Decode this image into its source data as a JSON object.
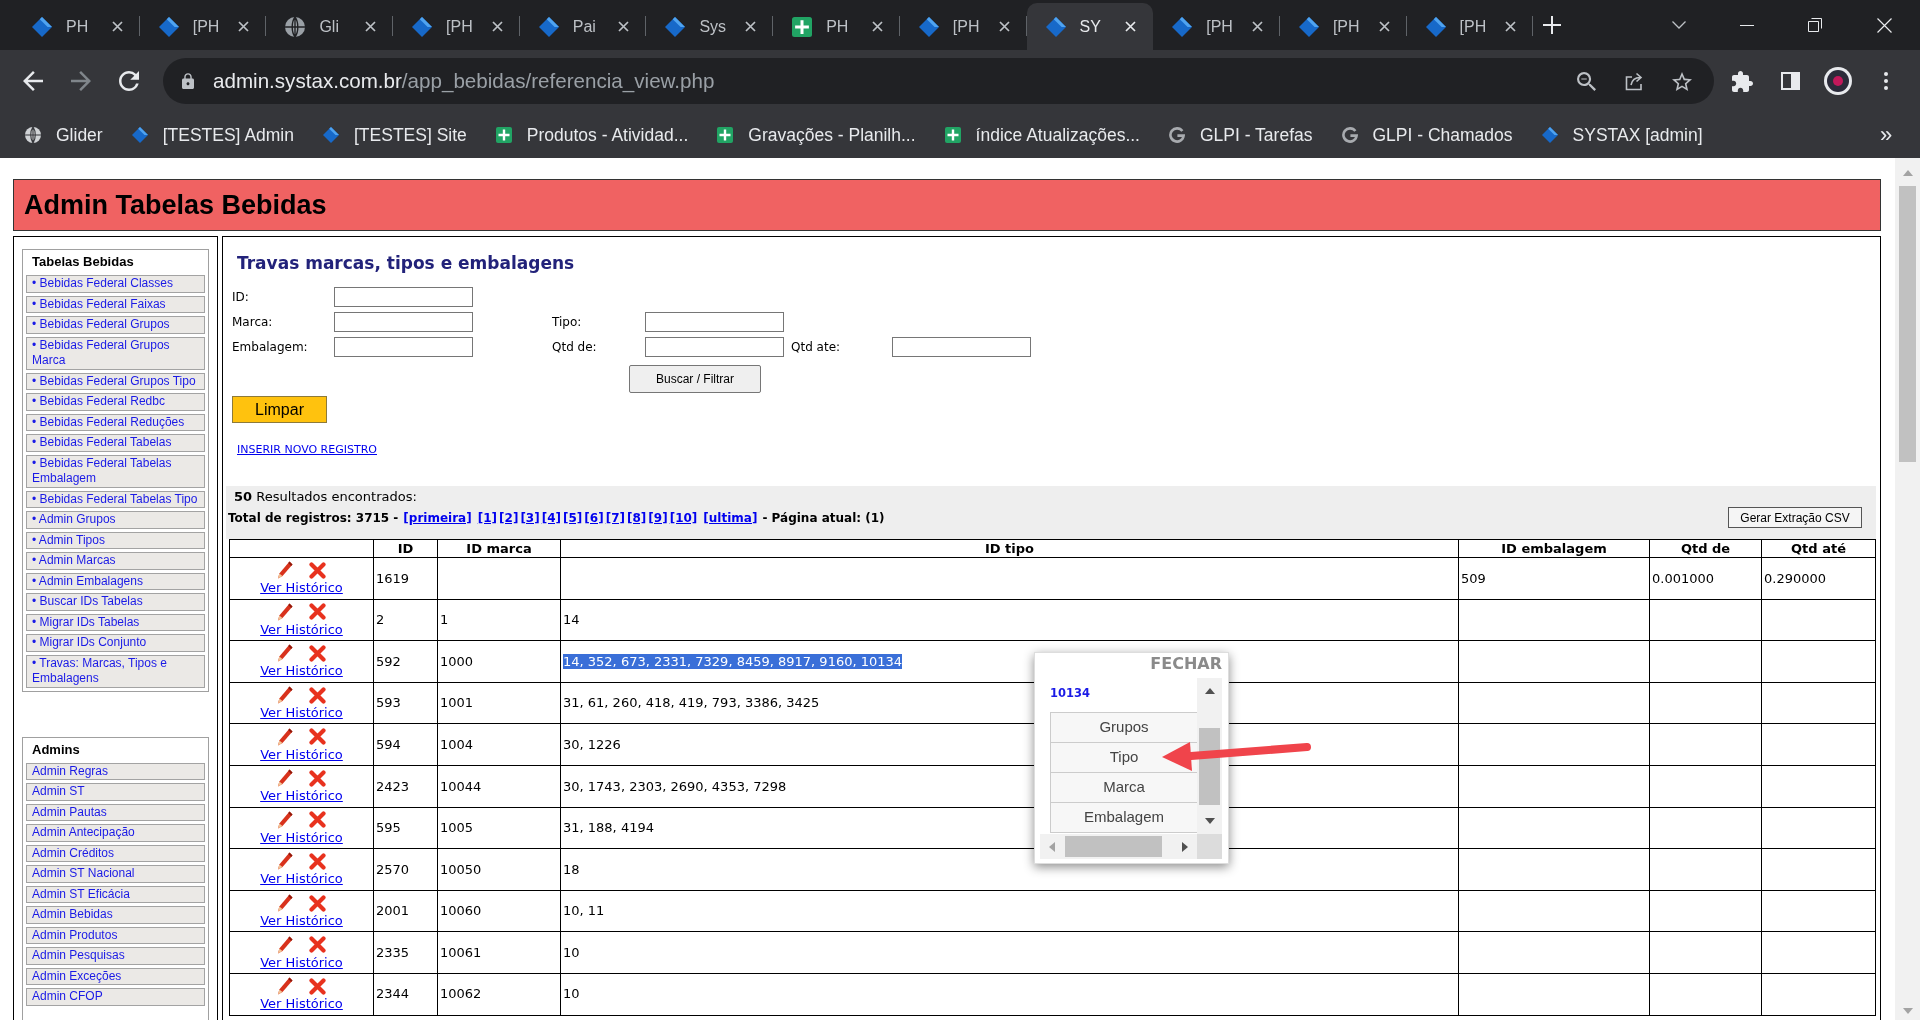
{
  "browser": {
    "tabs": [
      {
        "title": "PH",
        "kind": "diamond",
        "selected": false
      },
      {
        "title": "[PH",
        "kind": "diamond",
        "selected": false
      },
      {
        "title": "Gli",
        "kind": "globe",
        "selected": false
      },
      {
        "title": "[PH",
        "kind": "diamond",
        "selected": false
      },
      {
        "title": "Pai",
        "kind": "diamond",
        "selected": false
      },
      {
        "title": "Sys",
        "kind": "diamond",
        "selected": false
      },
      {
        "title": "PH",
        "kind": "plus",
        "selected": false
      },
      {
        "title": "[PH",
        "kind": "diamond",
        "selected": false
      },
      {
        "title": "SY",
        "kind": "diamond",
        "selected": true
      },
      {
        "title": "[PH",
        "kind": "diamond",
        "selected": false
      },
      {
        "title": "[PH",
        "kind": "diamond",
        "selected": false
      },
      {
        "title": "[PH",
        "kind": "diamond",
        "selected": false
      }
    ],
    "address": {
      "host": "admin.systax.com.br",
      "path": "/app_bebidas/referencia_view.php"
    },
    "bookmarks": [
      {
        "label": "Glider",
        "kind": "globe"
      },
      {
        "label": "[TESTES] Admin",
        "kind": "diamond"
      },
      {
        "label": "[TESTES] Site",
        "kind": "diamond"
      },
      {
        "label": "Produtos - Atividad...",
        "kind": "plus"
      },
      {
        "label": "Gravações - Planilh...",
        "kind": "plus"
      },
      {
        "label": "índice Atualizações...",
        "kind": "plus"
      },
      {
        "label": "GLPI - Tarefas",
        "kind": "g"
      },
      {
        "label": "GLPI - Chamados",
        "kind": "g"
      },
      {
        "label": "SYSTAX [admin]",
        "kind": "diamond"
      }
    ],
    "bookmarks_more": "»"
  },
  "page": {
    "header": "Admin Tabelas Bebidas",
    "sidebar": [
      {
        "title": "Tabelas Bebidas",
        "items": [
          "• Bebidas Federal Classes",
          "• Bebidas Federal Faixas",
          "• Bebidas Federal Grupos",
          "• Bebidas Federal Grupos Marca",
          "• Bebidas Federal Grupos Tipo",
          "• Bebidas Federal Redbc",
          "• Bebidas Federal Reduções",
          "• Bebidas Federal Tabelas",
          "• Bebidas Federal Tabelas Embalagem",
          "• Bebidas Federal Tabelas Tipo",
          "• Admin Grupos",
          "• Admin Tipos",
          "• Admin Marcas",
          "• Admin Embalagens",
          "• Buscar IDs Tabelas",
          "• Migrar IDs Tabelas",
          "• Migrar IDs Conjunto",
          "• Travas: Marcas, Tipos e Embalagens"
        ]
      },
      {
        "title": "Admins",
        "items": [
          "Admin Regras",
          "Admin ST",
          "Admin Pautas",
          "Admin Antecipação",
          "Admin Créditos",
          "Admin ST Nacional",
          "Admin ST Eficácia",
          "Admin Bebidas",
          "Admin Produtos",
          "Admin Pesquisas",
          "Admin Exceções",
          "Admin CFOP"
        ]
      }
    ],
    "form": {
      "title": "Travas marcas, tipos e embalagens",
      "field_rows": [
        [
          {
            "label": "ID:"
          }
        ],
        [
          {
            "label": "Marca:"
          },
          {
            "label": "Tipo:"
          }
        ],
        [
          {
            "label": "Embalagem:"
          },
          {
            "label": "Qtd de:"
          },
          {
            "label": "Qtd ate:"
          }
        ]
      ],
      "search_button": "Buscar / Filtrar",
      "clear_button": "Limpar",
      "insert_link": "INSERIR NOVO REGISTRO"
    },
    "results": {
      "summary": "**50** Resultados encontrados:",
      "total": "Total de registros: 3715 -",
      "page_links": [
        {
          "label": "[primeira]",
          "kind": "first"
        },
        {
          "label": "[1]",
          "kind": "number"
        },
        {
          "label": "[2]",
          "kind": "number"
        },
        {
          "label": "[3]",
          "kind": "number"
        },
        {
          "label": "[4]",
          "kind": "number"
        },
        {
          "label": "[5]",
          "kind": "number"
        },
        {
          "label": "[6]",
          "kind": "number"
        },
        {
          "label": "[7]",
          "kind": "number"
        },
        {
          "label": "[8]",
          "kind": "number"
        },
        {
          "label": "[9]",
          "kind": "number"
        },
        {
          "label": "[10]",
          "kind": "number"
        },
        {
          "label": "[ultima]",
          "kind": "last"
        }
      ],
      "current_page": "- Página atual: (1)",
      "csv_button": "Gerar Extração CSV"
    },
    "table": {
      "columns": [
        "ID",
        "ID marca",
        "ID tipo",
        "ID embalagem",
        "Qtd de",
        "Qtd até"
      ],
      "rows": [
        {
          "history_link": "Ver Histórico",
          "id": "1619",
          "id_embalagem": "509",
          "qtd_de": "0.001000",
          "qtd_ate": "0.290000"
        },
        {
          "history_link": "Ver Histórico",
          "id": "2",
          "id_marca": "1",
          "id_tipo": {
            "text": "14",
            "highlighted": false
          }
        },
        {
          "history_link": "Ver Histórico",
          "id": "592",
          "id_marca": "1000",
          "id_tipo": {
            "text": "14, 352, 673, 2331, 7329, 8459, 8917, 9160, 10134",
            "highlighted": true
          }
        },
        {
          "history_link": "Ver Histórico",
          "id": "593",
          "id_marca": "1001",
          "id_tipo": {
            "text": "31, 61, 260, 418, 419, 793, 3386, 3425",
            "highlighted": false
          }
        },
        {
          "history_link": "Ver Histórico",
          "id": "594",
          "id_marca": "1004",
          "id_tipo": {
            "text": "30, 1226",
            "highlighted": false
          }
        },
        {
          "history_link": "Ver Histórico",
          "id": "2423",
          "id_marca": "10044",
          "id_tipo": {
            "text": "30, 1743, 2303, 2690, 4353, 7298",
            "highlighted": false
          }
        },
        {
          "history_link": "Ver Histórico",
          "id": "595",
          "id_marca": "1005",
          "id_tipo": {
            "text": "31, 188, 4194",
            "highlighted": false
          }
        },
        {
          "history_link": "Ver Histórico",
          "id": "2570",
          "id_marca": "10050",
          "id_tipo": {
            "text": "18",
            "highlighted": false
          }
        },
        {
          "history_link": "Ver Histórico",
          "id": "2001",
          "id_marca": "10060",
          "id_tipo": {
            "text": "10, 11",
            "highlighted": false
          }
        },
        {
          "history_link": "Ver Histórico",
          "id": "2335",
          "id_marca": "10061",
          "id_tipo": {
            "text": "10",
            "highlighted": false
          }
        },
        {
          "history_link": "Ver Histórico",
          "id": "2344",
          "id_marca": "10062",
          "id_tipo": {
            "text": "10",
            "highlighted": false
          }
        }
      ]
    },
    "popup": {
      "close": "FECHAR",
      "text": "10134",
      "options": [
        "Grupos",
        "Tipo",
        "Marca",
        "Embalagem"
      ]
    }
  }
}
